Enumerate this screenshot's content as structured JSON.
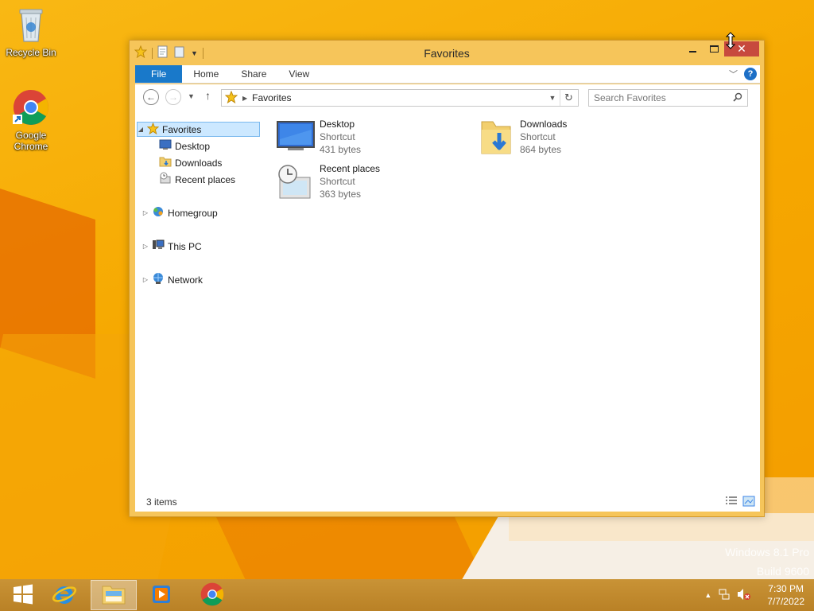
{
  "desktop": {
    "icons": [
      {
        "label": "Recycle Bin",
        "icon": "recycle-bin-icon"
      },
      {
        "label": "Google Chrome",
        "icon": "chrome-icon"
      }
    ],
    "watermark": {
      "line1": "Windows 8.1 Pro",
      "line2": "Build 9600"
    }
  },
  "window": {
    "title": "Favorites",
    "ribbon_tabs": [
      "File",
      "Home",
      "Share",
      "View"
    ],
    "help_label": "?",
    "address_text": "Favorites",
    "search_placeholder": "Search Favorites",
    "nav_tree": [
      {
        "label": "Favorites",
        "icon": "star-icon",
        "expanded": true,
        "selected": true
      },
      {
        "label": "Desktop",
        "icon": "desktop-icon"
      },
      {
        "label": "Downloads",
        "icon": "downloads-folder-icon"
      },
      {
        "label": "Recent places",
        "icon": "recent-places-icon"
      },
      {
        "label": "Homegroup",
        "icon": "homegroup-icon"
      },
      {
        "label": "This PC",
        "icon": "computer-icon"
      },
      {
        "label": "Network",
        "icon": "network-icon"
      }
    ],
    "files": [
      {
        "name": "Desktop",
        "type": "Shortcut",
        "size": "431 bytes",
        "icon": "desktop-icon"
      },
      {
        "name": "Downloads",
        "type": "Shortcut",
        "size": "864 bytes",
        "icon": "downloads-folder-icon"
      },
      {
        "name": "Recent places",
        "type": "Shortcut",
        "size": "363 bytes",
        "icon": "recent-places-icon"
      }
    ],
    "status": "3 items"
  },
  "taskbar": {
    "apps": [
      "start-icon",
      "internet-explorer-icon",
      "file-explorer-icon",
      "media-player-icon",
      "chrome-icon"
    ],
    "time": "7:30 PM",
    "date": "7/7/2022"
  },
  "colors": {
    "accent": "#1979ca",
    "close_button": "#c74a3e",
    "window_frame": "#f6c55a",
    "desktop": "#f7a900"
  }
}
